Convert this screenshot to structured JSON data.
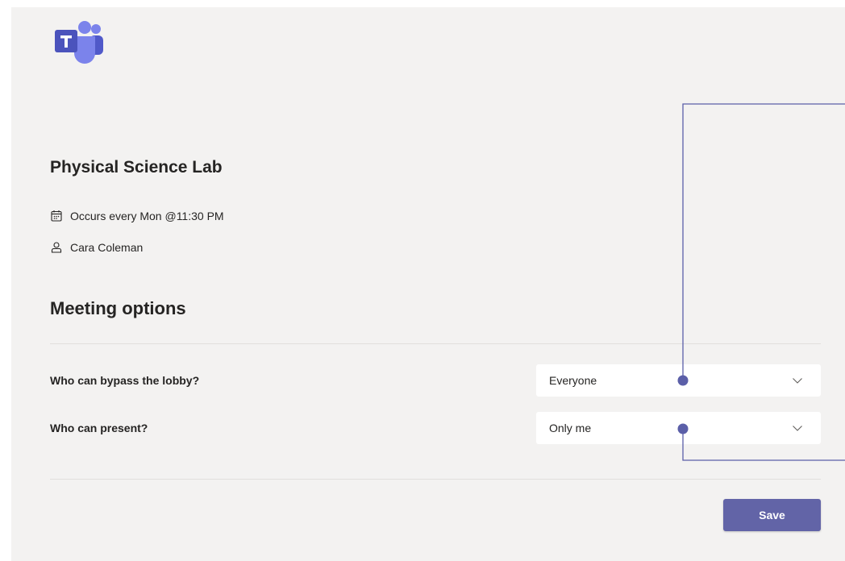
{
  "meeting": {
    "title": "Physical Science Lab",
    "schedule": "Occurs every Mon @11:30 PM",
    "organizer": "Cara Coleman"
  },
  "options": {
    "heading": "Meeting options",
    "lobby": {
      "label": "Who can bypass the lobby?",
      "value": "Everyone"
    },
    "present": {
      "label": "Who can present?",
      "value": "Only me"
    }
  },
  "actions": {
    "save_label": "Save"
  },
  "icons": {
    "logo": "microsoft-teams-logo",
    "schedule": "calendar-icon",
    "organizer": "person-icon",
    "dropdown": "chevron-down-icon"
  },
  "colors": {
    "background": "#f3f2f1",
    "accent": "#6264a7",
    "callout": "#5b5fa8"
  }
}
